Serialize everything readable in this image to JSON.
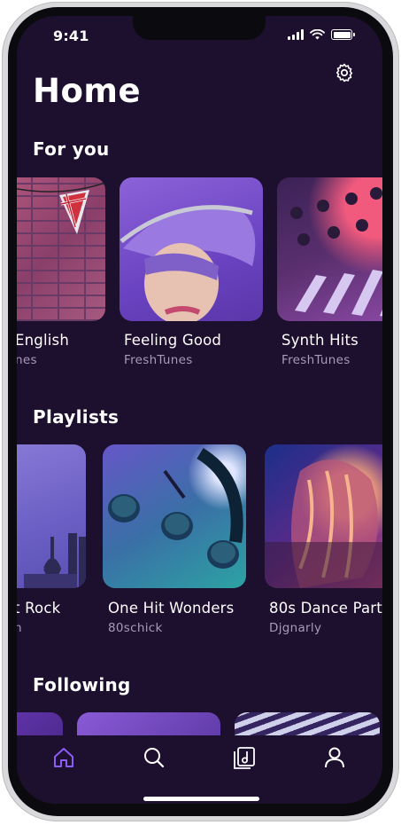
{
  "status_bar": {
    "time": "9:41"
  },
  "header": {
    "title": "Home",
    "settings_icon": "gear-icon"
  },
  "sections": {
    "for_you": {
      "title": "For you",
      "items": [
        {
          "title": "English",
          "subtitle": "nes"
        },
        {
          "title": "Feeling Good",
          "subtitle": "FreshTunes"
        },
        {
          "title": "Synth Hits",
          "subtitle": "FreshTunes"
        }
      ]
    },
    "playlists": {
      "title": "Playlists",
      "items": [
        {
          "title": "t Rock",
          "subtitle": "n"
        },
        {
          "title": "One Hit Wonders",
          "subtitle": "80schick"
        },
        {
          "title": "80s Dance Part",
          "subtitle": "Djgnarly"
        }
      ]
    },
    "following": {
      "title": "Following"
    }
  },
  "tab_bar": {
    "items": [
      {
        "name": "home",
        "icon": "home-icon",
        "active": true
      },
      {
        "name": "search",
        "icon": "search-icon",
        "active": false
      },
      {
        "name": "library",
        "icon": "music-library-icon",
        "active": false
      },
      {
        "name": "profile",
        "icon": "user-icon",
        "active": false
      }
    ]
  },
  "colors": {
    "background": "#1d0f2e",
    "accent": "#8b5cf6",
    "subtitle": "#a89bb8"
  }
}
